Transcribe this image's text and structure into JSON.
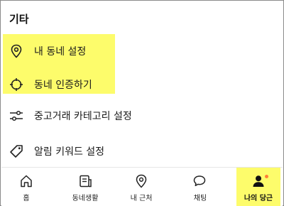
{
  "section": {
    "title": "기타"
  },
  "menu": [
    {
      "label": "내 동네 설정",
      "icon": "location-pin-icon"
    },
    {
      "label": "동네 인증하기",
      "icon": "crosshair-target-icon"
    },
    {
      "label": "중고거래 카테고리 설정",
      "icon": "sliders-icon"
    },
    {
      "label": "알림 키워드 설정",
      "icon": "tag-icon"
    }
  ],
  "tabs": [
    {
      "label": "홈",
      "icon": "home-icon"
    },
    {
      "label": "동네생활",
      "icon": "document-icon"
    },
    {
      "label": "내 근처",
      "icon": "location-pin-icon"
    },
    {
      "label": "채팅",
      "icon": "chat-bubbles-icon"
    },
    {
      "label": "나의 당근",
      "icon": "person-icon",
      "active": true
    }
  ],
  "colors": {
    "highlight": "#fdfc6b",
    "notification_dot": "#ff7e36"
  }
}
